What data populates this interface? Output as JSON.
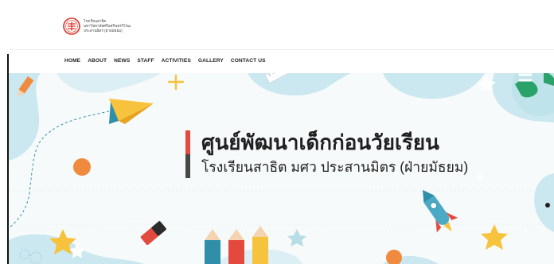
{
  "header": {
    "logo_lines": [
      "โรงเรียนสาธิต",
      "มหาวิทยาลัยศรีนครินทรวิโรฒ",
      "ประสานมิตร (ฝ่ายมัธยม)"
    ]
  },
  "nav": {
    "items": [
      {
        "label": "HOME"
      },
      {
        "label": "ABOUT"
      },
      {
        "label": "NEWS"
      },
      {
        "label": "STAFF"
      },
      {
        "label": "ACTIVITIES"
      },
      {
        "label": "GALLERY"
      },
      {
        "label": "CONTACT US"
      }
    ]
  },
  "hero": {
    "title": "ศูนย์พัฒนาเด็กก่อนวัยเรียน",
    "subtitle": "โรงเรียนสาธิต มศว ประสานมิตร (ฝ่ายมัธยม)"
  },
  "colors": {
    "accent_red": "#e34a3d",
    "accent_dark": "#474747",
    "blob_blue": "#cbe7ef",
    "orange": "#f08a3e",
    "yellow": "#f8c33c",
    "teal": "#2f8fa8"
  },
  "icons": [
    "school-logo-icon",
    "paper-plane-icon",
    "rocket-icon",
    "pencil-icon",
    "eraser-icon",
    "ruler-icon",
    "globe-icon",
    "star-icon",
    "plus-icon"
  ]
}
